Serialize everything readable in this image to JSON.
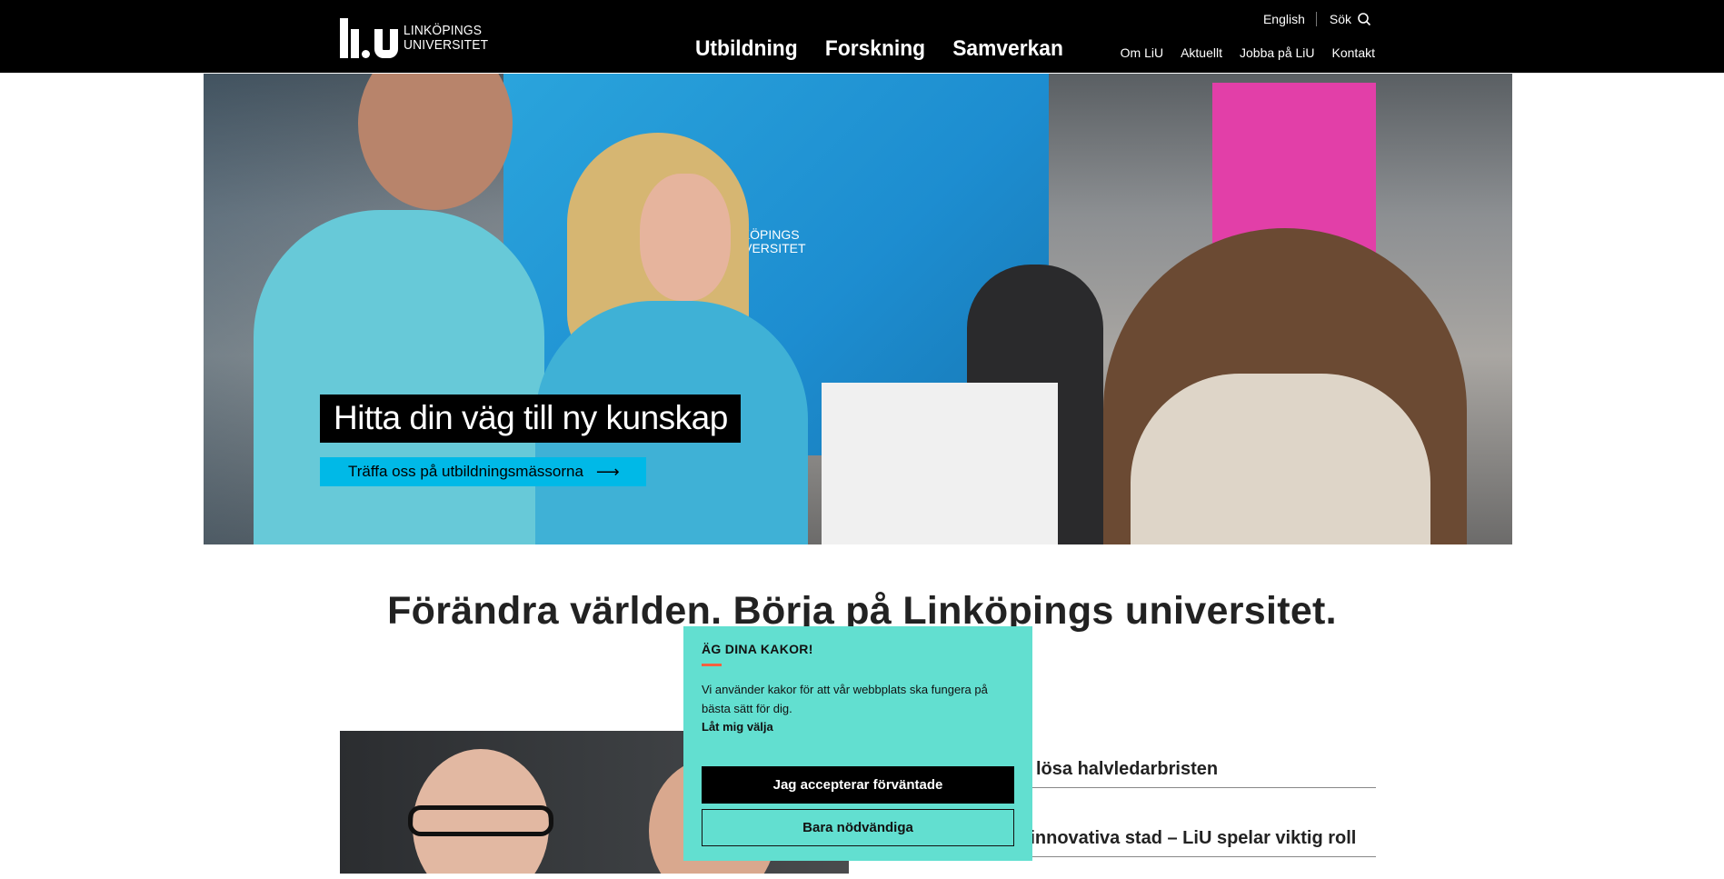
{
  "header": {
    "logo": {
      "line1": "LINKÖPINGS",
      "line2": "UNIVERSITET"
    },
    "main_nav": [
      "Utbildning",
      "Forskning",
      "Samverkan"
    ],
    "language_link": "English",
    "search_label": "Sök",
    "sub_nav": [
      "Om LiU",
      "Aktuellt",
      "Jobba på LiU",
      "Kontakt"
    ]
  },
  "hero": {
    "booth_logo": {
      "line1": "LINKÖPINGS",
      "line2": "UNIVERSITET"
    },
    "title": "Hitta din väg till ny kunskap",
    "cta_label": "Träffa oss på utbildningsmässorna",
    "cta_arrow": "⟶"
  },
  "headline": "Förändra världen. Börja på Linköpings universitet.",
  "news": {
    "items": [
      {
        "title": "att lösa halvledarbristen"
      },
      {
        "title": "st innovativa stad – LiU spelar viktig roll"
      }
    ]
  },
  "cookie": {
    "title": "ÄG DINA KAKOR!",
    "text": "Vi använder kakor för att vår webbplats ska fungera på bästa sätt för dig.",
    "choose_link": "Låt mig välja",
    "accept_button": "Jag accepterar förväntade",
    "necessary_button": "Bara nödvändiga",
    "accent_color": "#ff6040",
    "background_color": "#62dfd0"
  },
  "colors": {
    "header_bg": "#000000",
    "cta_bg": "#00b9e7"
  }
}
